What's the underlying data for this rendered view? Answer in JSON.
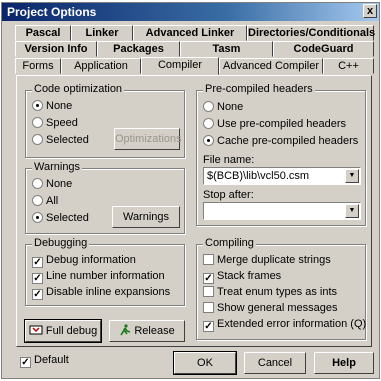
{
  "window": {
    "title": "Project Options",
    "close_glyph": "x"
  },
  "tabs_row1": [
    {
      "label": "Pascal"
    },
    {
      "label": "Linker"
    },
    {
      "label": "Advanced Linker"
    },
    {
      "label": "Directories/Conditionals"
    }
  ],
  "tabs_row2": [
    {
      "label": "Version Info"
    },
    {
      "label": "Packages"
    },
    {
      "label": "Tasm"
    },
    {
      "label": "CodeGuard"
    }
  ],
  "tabs_row3": [
    {
      "label": "Forms"
    },
    {
      "label": "Application"
    },
    {
      "label": "Compiler",
      "active": true
    },
    {
      "label": "Advanced Compiler"
    },
    {
      "label": "C++"
    }
  ],
  "code_optimization": {
    "title": "Code optimization",
    "options": [
      {
        "label": "None",
        "selected": true
      },
      {
        "label": "Speed",
        "selected": false
      },
      {
        "label": "Selected",
        "selected": false
      }
    ],
    "optimizations_button": "Optimizations"
  },
  "warnings": {
    "title": "Warnings",
    "options": [
      {
        "label": "None",
        "selected": false
      },
      {
        "label": "All",
        "selected": false
      },
      {
        "label": "Selected",
        "selected": true
      }
    ],
    "warnings_button": "Warnings"
  },
  "debugging": {
    "title": "Debugging",
    "options": [
      {
        "label": "Debug information",
        "checked": true
      },
      {
        "label": "Line number information",
        "checked": true
      },
      {
        "label": "Disable inline expansions",
        "checked": true
      }
    ]
  },
  "precompiled_headers": {
    "title": "Pre-compiled headers",
    "options": [
      {
        "label": "None",
        "selected": false
      },
      {
        "label": "Use pre-compiled headers",
        "selected": false
      },
      {
        "label": "Cache pre-compiled headers",
        "selected": true
      }
    ],
    "file_name_label": "File name:",
    "file_name_value": "$(BCB)\\lib\\vcl50.csm",
    "stop_after_label": "Stop after:",
    "stop_after_value": ""
  },
  "compiling": {
    "title": "Compiling",
    "options": [
      {
        "label": "Merge duplicate strings",
        "checked": false
      },
      {
        "label": "Stack frames",
        "checked": true
      },
      {
        "label": "Treat enum types as ints",
        "checked": false
      },
      {
        "label": "Show general messages",
        "checked": false
      },
      {
        "label": "Extended error information (Q)",
        "checked": true
      }
    ]
  },
  "buttons": {
    "full_debug": "Full debug",
    "release": "Release",
    "ok": "OK",
    "cancel": "Cancel",
    "help": "Help"
  },
  "default_checkbox": {
    "label": "Default",
    "checked": true
  },
  "icons": {
    "full_debug": "bug-icon",
    "release": "runner-icon",
    "check_glyph": "✓"
  },
  "colors": {
    "title_start": "#0a246a",
    "title_end": "#a6caf0",
    "face": "#d4d0c8"
  }
}
